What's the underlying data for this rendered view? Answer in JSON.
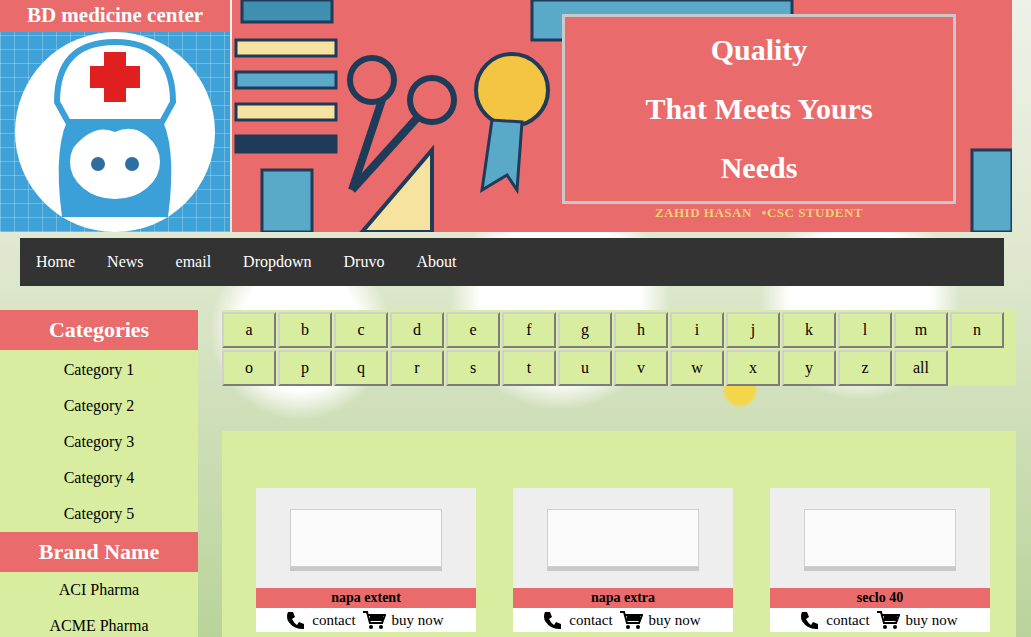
{
  "logo": {
    "title": "BD medicine center"
  },
  "banner": {
    "lines": [
      "Quality",
      "That Meets Yours",
      "Needs"
    ],
    "author": "ZAHID HASAN",
    "role": "•CSC STUDENT"
  },
  "nav": [
    "Home",
    "News",
    "email",
    "Dropdown",
    "Druvo",
    "About"
  ],
  "categories": {
    "title": "Categories",
    "items": [
      "Category 1",
      "Category 2",
      "Category 3",
      "Category 4",
      "Category 5"
    ]
  },
  "brands": {
    "title": "Brand Name",
    "items": [
      "ACI Pharma",
      "ACME Pharma"
    ]
  },
  "letters": [
    "a",
    "b",
    "c",
    "d",
    "e",
    "f",
    "g",
    "h",
    "i",
    "j",
    "k",
    "l",
    "m",
    "n",
    "o",
    "p",
    "q",
    "r",
    "s",
    "t",
    "u",
    "v",
    "w",
    "x",
    "y",
    "z",
    "all"
  ],
  "products": [
    {
      "name": "napa extent",
      "contact": "contact",
      "buy": "buy now"
    },
    {
      "name": "napa extra",
      "contact": "contact",
      "buy": "buy now"
    },
    {
      "name": "seclo 40",
      "contact": "contact",
      "buy": "buy now"
    }
  ]
}
